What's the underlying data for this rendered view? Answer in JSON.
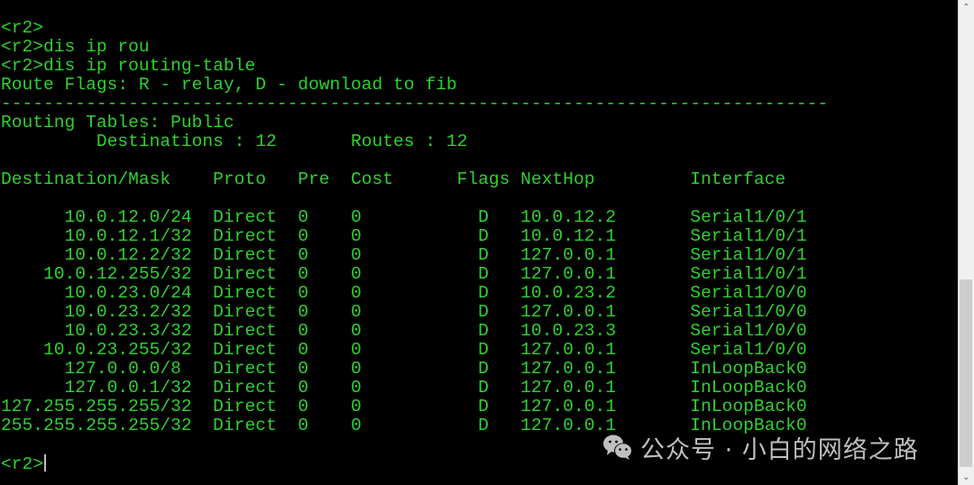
{
  "terminal": {
    "text_color": "#2fd12f",
    "background": "#000000",
    "lines": [
      "<r2>",
      "<r2>dis ip rou",
      "<r2>dis ip routing-table",
      "Route Flags: R - relay, D - download to fib",
      "------------------------------------------------------------------------------",
      "Routing Tables: Public",
      "         Destinations : 12       Routes : 12",
      "",
      "Destination/Mask    Proto   Pre  Cost      Flags NextHop         Interface",
      "",
      "      10.0.12.0/24  Direct  0    0           D   10.0.12.2       Serial1/0/1",
      "      10.0.12.1/32  Direct  0    0           D   10.0.12.1       Serial1/0/1",
      "      10.0.12.2/32  Direct  0    0           D   127.0.0.1       Serial1/0/1",
      "    10.0.12.255/32  Direct  0    0           D   127.0.0.1       Serial1/0/1",
      "      10.0.23.0/24  Direct  0    0           D   10.0.23.2       Serial1/0/0",
      "      10.0.23.2/32  Direct  0    0           D   127.0.0.1       Serial1/0/0",
      "      10.0.23.3/32  Direct  0    0           D   10.0.23.3       Serial1/0/0",
      "    10.0.23.255/32  Direct  0    0           D   127.0.0.1       Serial1/0/0",
      "      127.0.0.0/8   Direct  0    0           D   127.0.0.1       InLoopBack0",
      "      127.0.0.1/32  Direct  0    0           D   127.0.0.1       InLoopBack0",
      "127.255.255.255/32  Direct  0    0           D   127.0.0.1       InLoopBack0",
      "255.255.255.255/32  Direct  0    0           D   127.0.0.1       InLoopBack0",
      ""
    ],
    "prompt": "<r2>"
  },
  "routing_table": {
    "route_flags_legend": "Route Flags: R - relay, D - download to fib",
    "table_name": "Routing Tables: Public",
    "destinations": 12,
    "routes": 12,
    "columns": [
      "Destination/Mask",
      "Proto",
      "Pre",
      "Cost",
      "Flags",
      "NextHop",
      "Interface"
    ],
    "rows": [
      [
        "10.0.12.0/24",
        "Direct",
        "0",
        "0",
        "D",
        "10.0.12.2",
        "Serial1/0/1"
      ],
      [
        "10.0.12.1/32",
        "Direct",
        "0",
        "0",
        "D",
        "10.0.12.1",
        "Serial1/0/1"
      ],
      [
        "10.0.12.2/32",
        "Direct",
        "0",
        "0",
        "D",
        "127.0.0.1",
        "Serial1/0/1"
      ],
      [
        "10.0.12.255/32",
        "Direct",
        "0",
        "0",
        "D",
        "127.0.0.1",
        "Serial1/0/1"
      ],
      [
        "10.0.23.0/24",
        "Direct",
        "0",
        "0",
        "D",
        "10.0.23.2",
        "Serial1/0/0"
      ],
      [
        "10.0.23.2/32",
        "Direct",
        "0",
        "0",
        "D",
        "127.0.0.1",
        "Serial1/0/0"
      ],
      [
        "10.0.23.3/32",
        "Direct",
        "0",
        "0",
        "D",
        "10.0.23.3",
        "Serial1/0/0"
      ],
      [
        "10.0.23.255/32",
        "Direct",
        "0",
        "0",
        "D",
        "127.0.0.1",
        "Serial1/0/0"
      ],
      [
        "127.0.0.0/8",
        "Direct",
        "0",
        "0",
        "D",
        "127.0.0.1",
        "InLoopBack0"
      ],
      [
        "127.0.0.1/32",
        "Direct",
        "0",
        "0",
        "D",
        "127.0.0.1",
        "InLoopBack0"
      ],
      [
        "127.255.255.255/32",
        "Direct",
        "0",
        "0",
        "D",
        "127.0.0.1",
        "InLoopBack0"
      ],
      [
        "255.255.255.255/32",
        "Direct",
        "0",
        "0",
        "D",
        "127.0.0.1",
        "InLoopBack0"
      ]
    ]
  },
  "watermark": {
    "icon": "wechat-icon",
    "text": "公众号 · 小白的网络之路",
    "color": "#bfbfbf"
  },
  "scrollbar": {
    "up_icon": "chevron-up-icon",
    "down_icon": "chevron-down-icon",
    "up_glyph": "⌃",
    "down_glyph": "⌄",
    "position": "bottom"
  }
}
